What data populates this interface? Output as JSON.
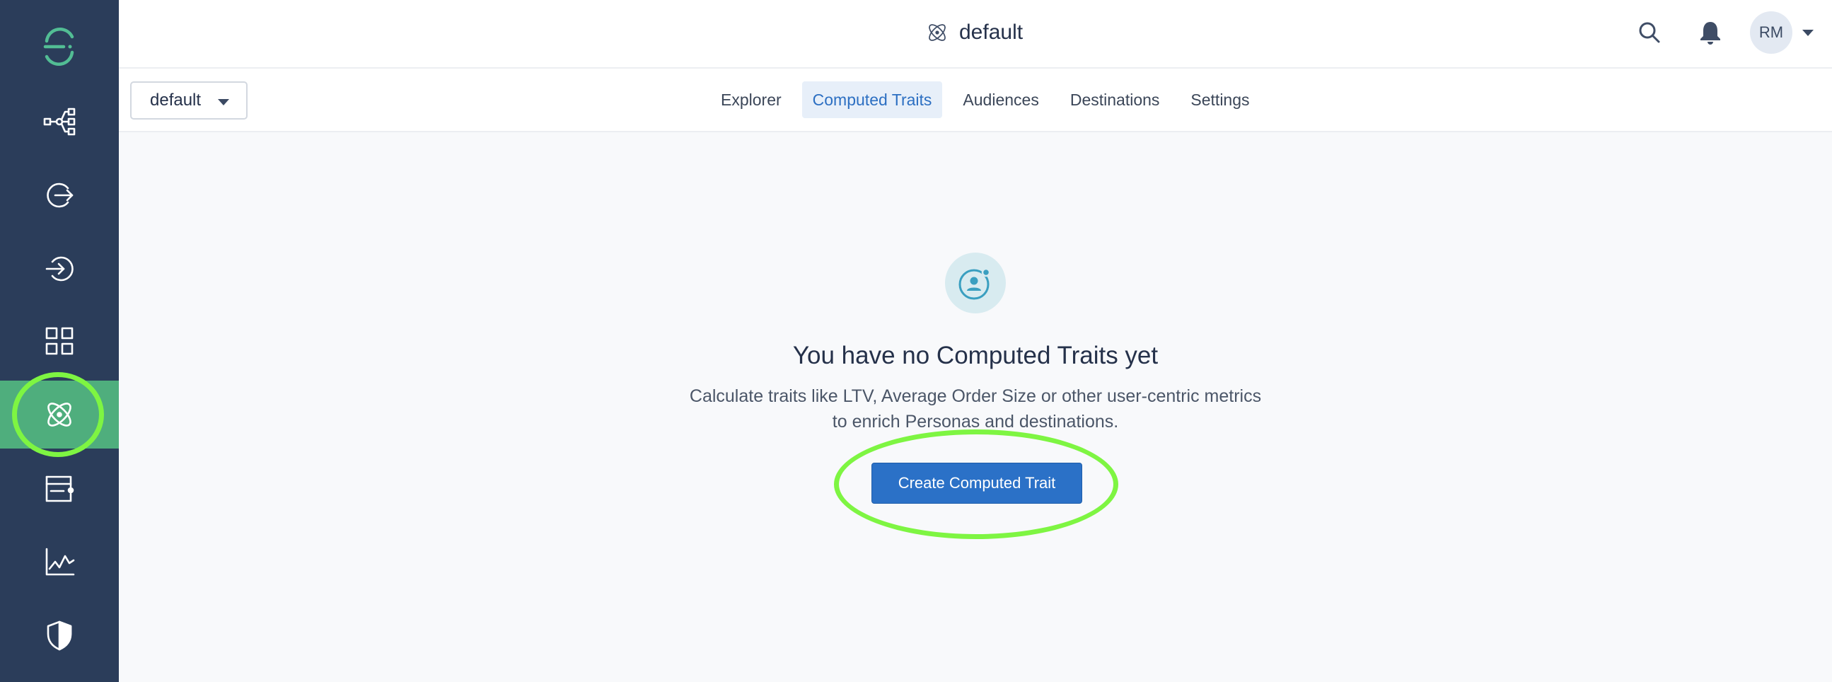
{
  "sidebar": {
    "items": [
      {
        "name": "segment-logo-icon"
      },
      {
        "name": "connections-icon"
      },
      {
        "name": "sources-icon"
      },
      {
        "name": "destinations-icon"
      },
      {
        "name": "catalog-icon"
      },
      {
        "name": "personas-icon",
        "active": true
      },
      {
        "name": "protocols-icon"
      },
      {
        "name": "analytics-icon"
      },
      {
        "name": "privacy-icon"
      }
    ]
  },
  "header": {
    "workspace_name": "default",
    "avatar_initials": "RM"
  },
  "subnav": {
    "space_select_value": "default",
    "tabs": [
      {
        "label": "Explorer",
        "active": false
      },
      {
        "label": "Computed Traits",
        "active": true
      },
      {
        "label": "Audiences",
        "active": false
      },
      {
        "label": "Destinations",
        "active": false
      },
      {
        "label": "Settings",
        "active": false
      }
    ]
  },
  "empty_state": {
    "title": "You have no Computed Traits yet",
    "description_line1": "Calculate traits like LTV, Average Order Size or other user-centric metrics",
    "description_line2": "to enrich Personas and destinations.",
    "button_label": "Create Computed Trait"
  },
  "colors": {
    "sidebar_bg": "#2b3d5a",
    "sidebar_active": "#4fae7d",
    "primary_button": "#2b71c7",
    "annotation_highlight": "#7ef542",
    "active_tab_text": "#2c6fc2"
  }
}
